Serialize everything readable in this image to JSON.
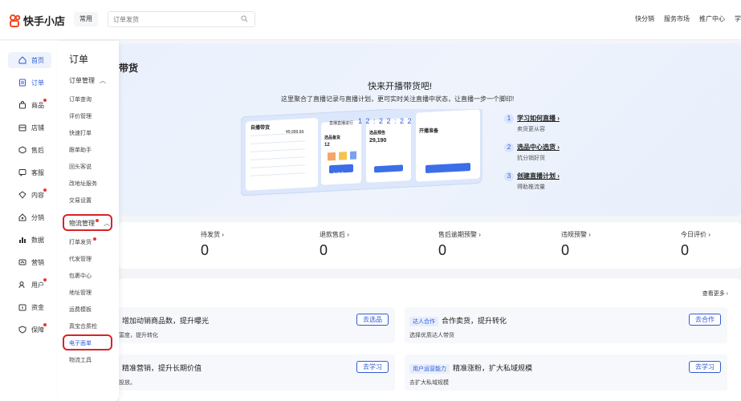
{
  "header": {
    "logo_text": "快手小店",
    "common_tag": "常用",
    "search_placeholder": "订单发货",
    "nav": [
      "快分销",
      "服务市场",
      "推广中心",
      "学"
    ]
  },
  "sidebar": {
    "items": [
      {
        "label": "首页",
        "icon": "home-icon",
        "dot": false,
        "active": true
      },
      {
        "label": "订单",
        "icon": "order-icon",
        "dot": false,
        "active": false
      },
      {
        "label": "商品",
        "icon": "bag-icon",
        "dot": true,
        "active": false
      },
      {
        "label": "店铺",
        "icon": "store-icon",
        "dot": false,
        "active": false
      },
      {
        "label": "售后",
        "icon": "aftersale-icon",
        "dot": false,
        "active": false
      },
      {
        "label": "客服",
        "icon": "chat-icon",
        "dot": false,
        "active": false
      },
      {
        "label": "内容",
        "icon": "content-icon",
        "dot": true,
        "active": false
      },
      {
        "label": "分销",
        "icon": "share-icon",
        "dot": false,
        "active": false
      },
      {
        "label": "数据",
        "icon": "chart-icon",
        "dot": false,
        "active": false
      },
      {
        "label": "营销",
        "icon": "marketing-icon",
        "dot": false,
        "active": false
      },
      {
        "label": "用户",
        "icon": "user-icon",
        "dot": true,
        "active": false
      },
      {
        "label": "资金",
        "icon": "wallet-icon",
        "dot": false,
        "active": false
      },
      {
        "label": "保障",
        "icon": "shield-icon",
        "dot": true,
        "active": false
      }
    ]
  },
  "submenu": {
    "title": "订单",
    "group1": {
      "label": "订单管理",
      "chevron": "︿"
    },
    "group1_items": [
      "订单查询",
      "评价管理",
      "快速打单",
      "跟单助手",
      "回头客说",
      "改地址服务",
      "交易设置"
    ],
    "group2": {
      "label": "物流管理",
      "chevron": "︿"
    },
    "group2_items": [
      "打单发货",
      "代发管理",
      "包裹中心",
      "地址管理",
      "运费模板",
      "真宝合质检",
      "电子面单",
      "物流工具"
    ],
    "selected_item": "电子面单"
  },
  "banner": {
    "page_title": "带货",
    "heading": "快来开播带货吧!",
    "subtext": "这里聚合了直播记录与直播计划，更可实时关注直播中状态，让直播一步一个脚印!",
    "steps": [
      {
        "num": "1",
        "title": "学习如何直播 ›",
        "desc": "卖货更从容"
      },
      {
        "num": "2",
        "title": "选品中心选货 ›",
        "desc": "抗分销好货"
      },
      {
        "num": "3",
        "title": "创建直播计划 ›",
        "desc": "得助推流量"
      }
    ],
    "illus": {
      "card1_title": "自播带货",
      "card1_value": "¥9,999.99",
      "card2_title": "直播直播进行",
      "timer": "1 2 : 2 2 : 2 2",
      "card3_title": "选品备货",
      "card3_count": "12",
      "card4_title": "选品预告",
      "card4_value": "29,190",
      "card5_title": "开播准备",
      "card5_button": "去设置",
      "small_btn": "去选品"
    }
  },
  "stats": [
    {
      "label": "待发货 ›",
      "value": "0"
    },
    {
      "label": "退款售后 ›",
      "value": "0"
    },
    {
      "label": "售后逾期预警 ›",
      "value": "0"
    },
    {
      "label": "违规预警 ›",
      "value": "0"
    },
    {
      "label": "今日评价 ›",
      "value": "0"
    }
  ],
  "tasks": {
    "more": "查看更多 ›",
    "items": [
      {
        "tag": "",
        "title": "增加动销商品数，提升曝光",
        "desc": "富度，提升转化",
        "button": "去选品"
      },
      {
        "tag": "达人合作",
        "title": "合作卖货，提升转化",
        "desc": "选择优质达人带货",
        "button": "去合作"
      },
      {
        "tag": "",
        "title": "精准营销，提升长期价值",
        "desc": "投放。",
        "button": "去学习"
      },
      {
        "tag": "用户运营能力",
        "title": "精准涨粉，扩大私域规模",
        "desc": "去扩大私域规模",
        "button": "去学习"
      }
    ]
  },
  "colors": {
    "accent": "#2f5bd8",
    "highlight_ring": "#d8232a",
    "logo": "#f04a24"
  }
}
